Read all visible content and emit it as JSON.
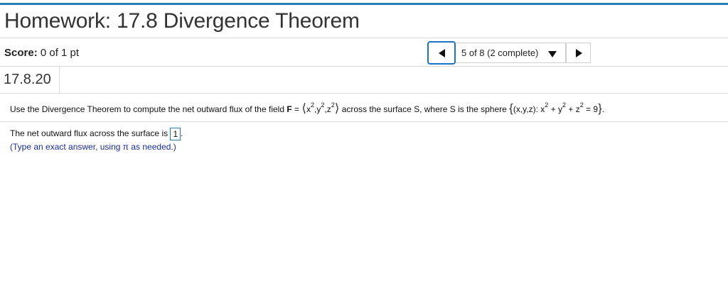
{
  "header": {
    "title": "Homework: 17.8 Divergence Theorem",
    "accent_color": "#2b7ab8"
  },
  "score": {
    "label": "Score:",
    "value": "0 of 1 pt"
  },
  "nav": {
    "prev_icon": "triangle-left-icon",
    "selector_text": "5 of 8 (2 complete)",
    "dropdown_icon": "triangle-down-icon",
    "next_icon": "triangle-right-icon",
    "focus_color": "#1a73c9"
  },
  "question": {
    "number": "17.8.20",
    "prompt_start": "Use the Divergence Theorem to compute the net outward flux of the field ",
    "field_symbol": "F",
    "equals": " = ",
    "field_components": [
      {
        "base": "x",
        "exp": "2"
      },
      {
        "base": "y",
        "exp": "2"
      },
      {
        "base": "z",
        "exp": "2"
      }
    ],
    "prompt_middle": " across the surface S, where S is the sphere ",
    "set_prefix": "(x,y,z): ",
    "sphere_terms": [
      {
        "base": "x",
        "exp": "2"
      },
      {
        "base": "y",
        "exp": "2"
      },
      {
        "base": "z",
        "exp": "2"
      }
    ],
    "sphere_rhs": " = 9",
    "prompt_end": "."
  },
  "answer": {
    "label": "The net outward flux across the surface is ",
    "value": "1",
    "suffix": ".",
    "hint": "(Type an exact answer, using π as needed.)",
    "hint_color": "#1a2d9c"
  }
}
